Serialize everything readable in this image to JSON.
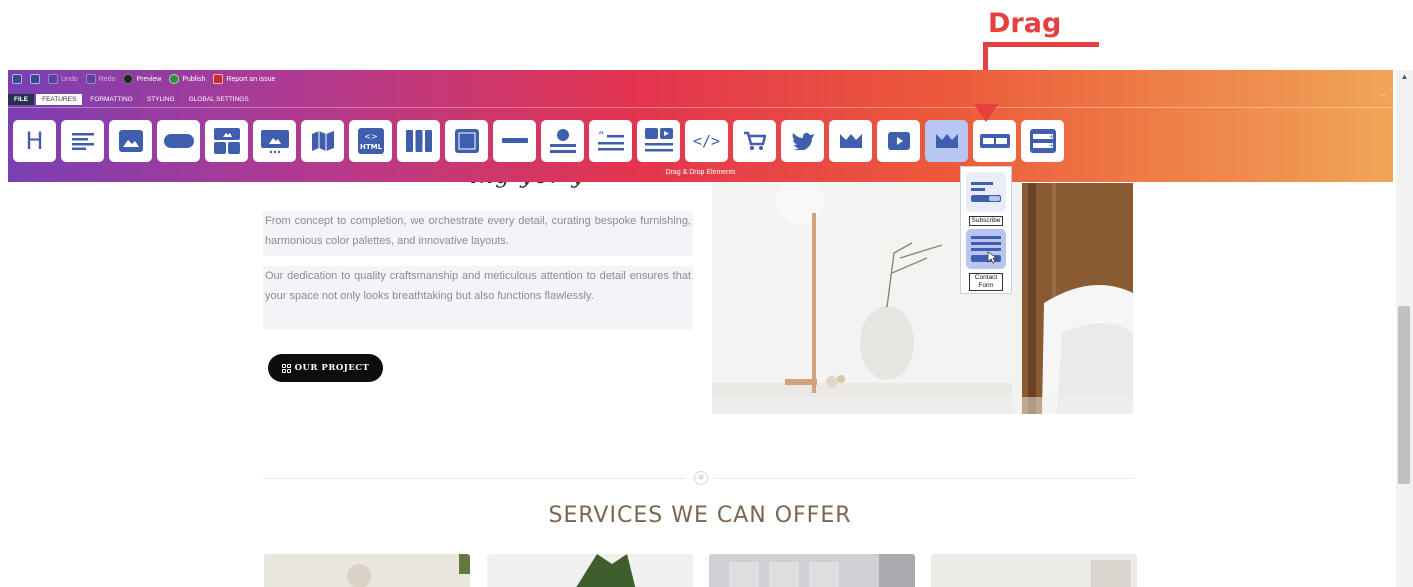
{
  "annotation": {
    "label": "Drag",
    "color": "#e5403f"
  },
  "toolbar": {
    "actions": [
      {
        "label": "Undo",
        "icon": "undo-icon"
      },
      {
        "label": "Redo",
        "icon": "redo-icon"
      },
      {
        "label": "Preview",
        "icon": "preview-icon"
      },
      {
        "label": "Publish",
        "icon": "publish-icon"
      },
      {
        "label": "Report an issue",
        "icon": "report-icon"
      }
    ],
    "tabs": [
      "FILE",
      "FEATURES",
      "FORMATTING",
      "STYLING",
      "GLOBAL SETTINGS"
    ],
    "active_tab": "FEATURES",
    "elements": [
      "heading-icon",
      "text-icon",
      "image-icon",
      "button-icon",
      "gallery-icon",
      "carousel-icon",
      "map-icon",
      "html-icon",
      "columns-icon",
      "box-icon",
      "divider-icon",
      "testimonial-icon",
      "quote-icon",
      "media-text-icon",
      "code-icon",
      "cart-icon",
      "twitter-icon",
      "crown-icon",
      "video-icon",
      "crown-icon-selected",
      "double-button-icon",
      "form-icon"
    ],
    "html_label": "HTML",
    "code_label": "</>",
    "footer": "Drag & Drop Elements"
  },
  "dropdown": {
    "items": [
      {
        "label": "Subscribe"
      },
      {
        "label": "Contact Form"
      }
    ]
  },
  "page": {
    "heading_partial": "ing  yor  y",
    "para1": "From concept to completion, we orchestrate every detail, curating bespoke furnishing, harmonious color palettes, and innovative layouts.",
    "para2": "Our dedication to quality craftsmanship and meticulous attention to detail ensures that your space not only looks breathtaking but also functions flawlessly.",
    "button": "OUR PROJECT",
    "services_title": "SERVICES WE CAN OFFER"
  }
}
